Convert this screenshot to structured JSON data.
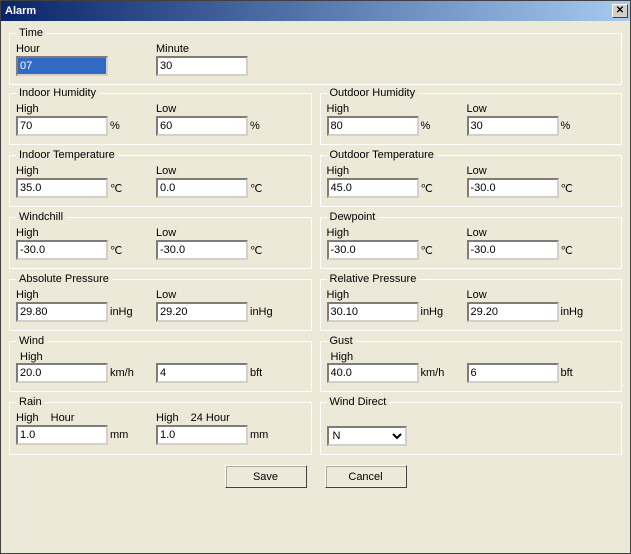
{
  "window": {
    "title": "Alarm"
  },
  "groups": {
    "time": {
      "legend": "Time",
      "hour_label": "Hour",
      "minute_label": "Minute"
    },
    "indoor_humidity": {
      "legend": "Indoor Humidity"
    },
    "outdoor_humidity": {
      "legend": "Outdoor Humidity"
    },
    "indoor_temp": {
      "legend": "Indoor Temperature"
    },
    "outdoor_temp": {
      "legend": "Outdoor Temperature"
    },
    "windchill": {
      "legend": "Windchill"
    },
    "dewpoint": {
      "legend": "Dewpoint"
    },
    "abs_pressure": {
      "legend": "Absolute Pressure"
    },
    "rel_pressure": {
      "legend": "Relative Pressure"
    },
    "wind": {
      "legend": "Wind"
    },
    "gust": {
      "legend": "Gust"
    },
    "rain": {
      "legend": "Rain",
      "high_label": "High",
      "hour_label": "Hour",
      "h24_label": "24 Hour"
    },
    "wind_dir": {
      "legend": "Wind Direct"
    }
  },
  "labels": {
    "high": "High",
    "low": "Low"
  },
  "units": {
    "pct": "%",
    "degc": "℃",
    "inhg": "inHg",
    "kmh": "km/h",
    "bft": "bft",
    "mm": "mm"
  },
  "values": {
    "time": {
      "hour": "07",
      "minute": "30"
    },
    "indoor_humidity": {
      "high": "70",
      "low": "60"
    },
    "outdoor_humidity": {
      "high": "80",
      "low": "30"
    },
    "indoor_temp": {
      "high": "35.0",
      "low": "0.0"
    },
    "outdoor_temp": {
      "high": "45.0",
      "low": "-30.0"
    },
    "windchill": {
      "high": "-30.0",
      "low": "-30.0"
    },
    "dewpoint": {
      "high": "-30.0",
      "low": "-30.0"
    },
    "abs_pressure": {
      "high": "29.80",
      "low": "29.20"
    },
    "rel_pressure": {
      "high": "30.10",
      "low": "29.20"
    },
    "wind": {
      "kmh": "20.0",
      "bft": "4"
    },
    "gust": {
      "kmh": "40.0",
      "bft": "6"
    },
    "rain": {
      "hour": "1.0",
      "h24": "1.0"
    },
    "wind_dir": "N"
  },
  "buttons": {
    "save": "Save",
    "cancel": "Cancel"
  }
}
